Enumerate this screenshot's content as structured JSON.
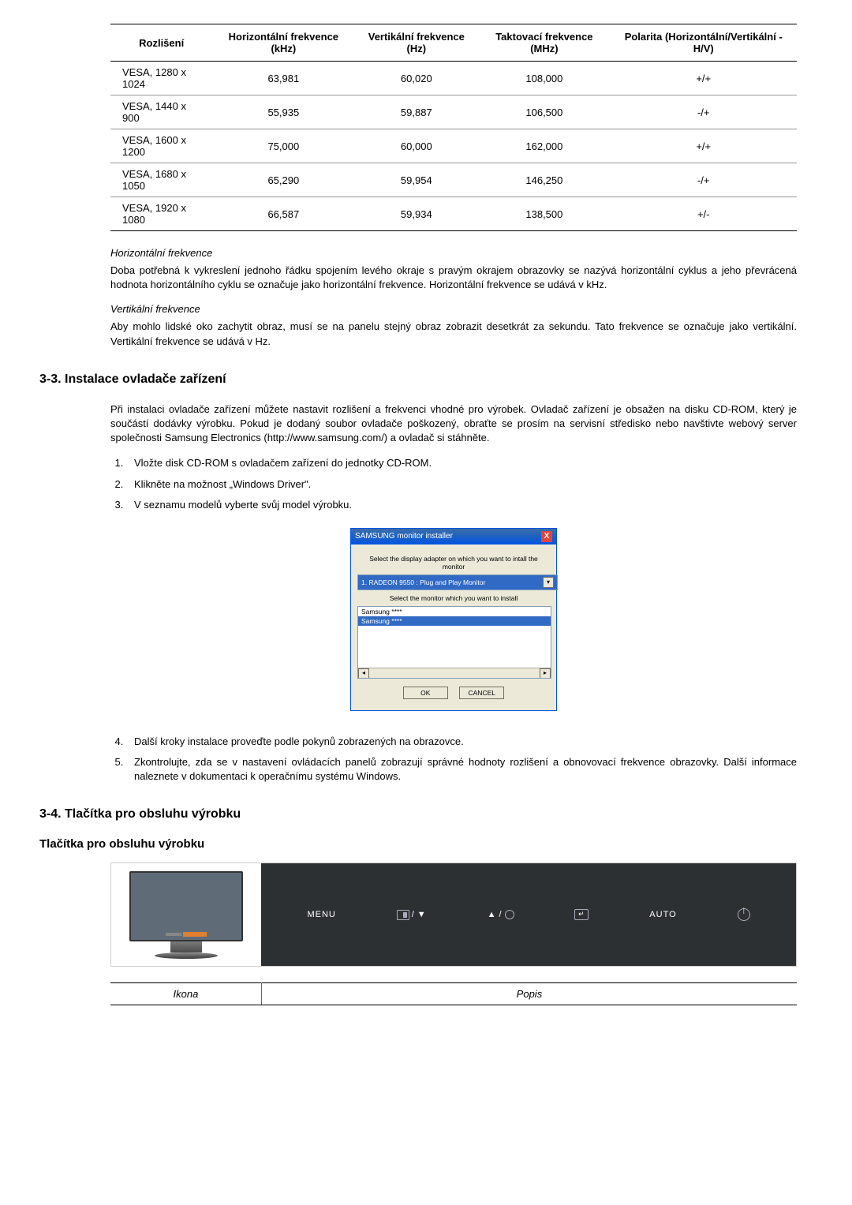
{
  "table1": {
    "headers": [
      "Rozlišení",
      "Horizontální frekvence (kHz)",
      "Vertikální frekvence (Hz)",
      "Taktovací frekvence (MHz)",
      "Polarita (Horizontální/Vertikální - H/V)"
    ],
    "rows": [
      [
        "VESA, 1280 x 1024",
        "63,981",
        "60,020",
        "108,000",
        "+/+"
      ],
      [
        "VESA, 1440 x 900",
        "55,935",
        "59,887",
        "106,500",
        "-/+"
      ],
      [
        "VESA, 1600 x 1200",
        "75,000",
        "60,000",
        "162,000",
        "+/+"
      ],
      [
        "VESA, 1680 x 1050",
        "65,290",
        "59,954",
        "146,250",
        "-/+"
      ],
      [
        "VESA, 1920 x 1080",
        "66,587",
        "59,934",
        "138,500",
        "+/-"
      ]
    ]
  },
  "freq": {
    "h_title": "Horizontální frekvence",
    "h_text": "Doba potřebná k vykreslení jednoho řádku spojením levého okraje s pravým okrajem obrazovky se nazývá horizontální cyklus a jeho převrácená hodnota horizontálního cyklu se označuje jako horizontální frekvence. Horizontální frekvence se udává v kHz.",
    "v_title": "Vertikální frekvence",
    "v_text": "Aby mohlo lidské oko zachytit obraz, musí se na panelu stejný obraz zobrazit desetkrát za sekundu. Tato frekvence se označuje jako vertikální. Vertikální frekvence se udává v Hz."
  },
  "sec33": {
    "title": "3-3. Instalace ovladače zařízení",
    "intro": "Při instalaci ovladače zařízení můžete nastavit rozlišení a frekvenci vhodné pro výrobek. Ovladač zařízení je obsažen na disku CD-ROM, který je součástí dodávky výrobku. Pokud je dodaný soubor ovladače poškozený, obraťte se prosím na servisní středisko nebo navštivte webový server společnosti Samsung Electronics (http://www.samsung.com/) a ovladač si stáhněte.",
    "steps": [
      "Vložte disk CD-ROM s ovladačem zařízení do jednotky CD-ROM.",
      "Klikněte na možnost „Windows Driver\".",
      "V seznamu modelů vyberte svůj model výrobku.",
      "Další kroky instalace proveďte podle pokynů zobrazených na obrazovce.",
      "Zkontrolujte, zda se v nastavení ovládacích panelů zobrazují správné hodnoty rozlišení a obnovovací frekvence obrazovky. Další informace naleznete v dokumentaci k operačnímu systému Windows."
    ]
  },
  "installer": {
    "title": "SAMSUNG monitor installer",
    "label1": "Select the display adapter on which you want to intall the monitor",
    "select_val": "1. RADEON 9550 : Plug and Play Monitor",
    "label2": "Select the monitor which you want to install",
    "item1": "Samsung ****",
    "item2": "Samsung ****",
    "ok": "OK",
    "cancel": "CANCEL"
  },
  "sec34": {
    "title": "3-4. Tlačítka pro obsluhu výrobku",
    "subtitle": "Tlačítka pro obsluhu výrobku"
  },
  "buttons": {
    "b1": "MENU",
    "b2": "▼",
    "b3": "▲",
    "b5": "AUTO"
  },
  "icon_table": {
    "h1": "Ikona",
    "h2": "Popis"
  }
}
